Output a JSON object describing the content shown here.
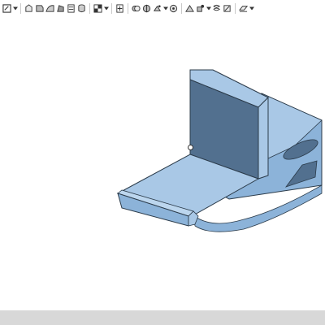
{
  "toolbar": {
    "groups": [
      {
        "icons": [
          "sketch-icon"
        ],
        "caret": true
      },
      {
        "icons": [
          "extrude-icon",
          "revolve-icon",
          "sweep-icon",
          "loft-icon",
          "thicken-icon"
        ],
        "caret": false
      },
      {
        "icons": [
          "fillet-icon",
          "chamfer-icon",
          "shell-icon"
        ],
        "caret": false
      },
      {
        "icons": [
          "draft-icon"
        ],
        "caret": true
      },
      {
        "icons": [
          "boolean-icon"
        ],
        "caret": false
      },
      {
        "icons": [
          "split-icon",
          "transform-icon",
          "pattern-icon"
        ],
        "caret": true
      },
      {
        "icons": [
          "mirror-icon",
          "mate-icon",
          "helix-icon"
        ],
        "caret": true
      },
      {
        "icons": [
          "plane-icon",
          "variable-icon"
        ],
        "caret": true
      }
    ]
  },
  "colors": {
    "model_face_light": "#a9c8e6",
    "model_face_mid": "#8cb3d9",
    "model_face_dark": "#52708f",
    "model_edge": "#2b3b4a",
    "bottom_bar": "#d8d8d8",
    "toolbar_icon": "#333333"
  }
}
